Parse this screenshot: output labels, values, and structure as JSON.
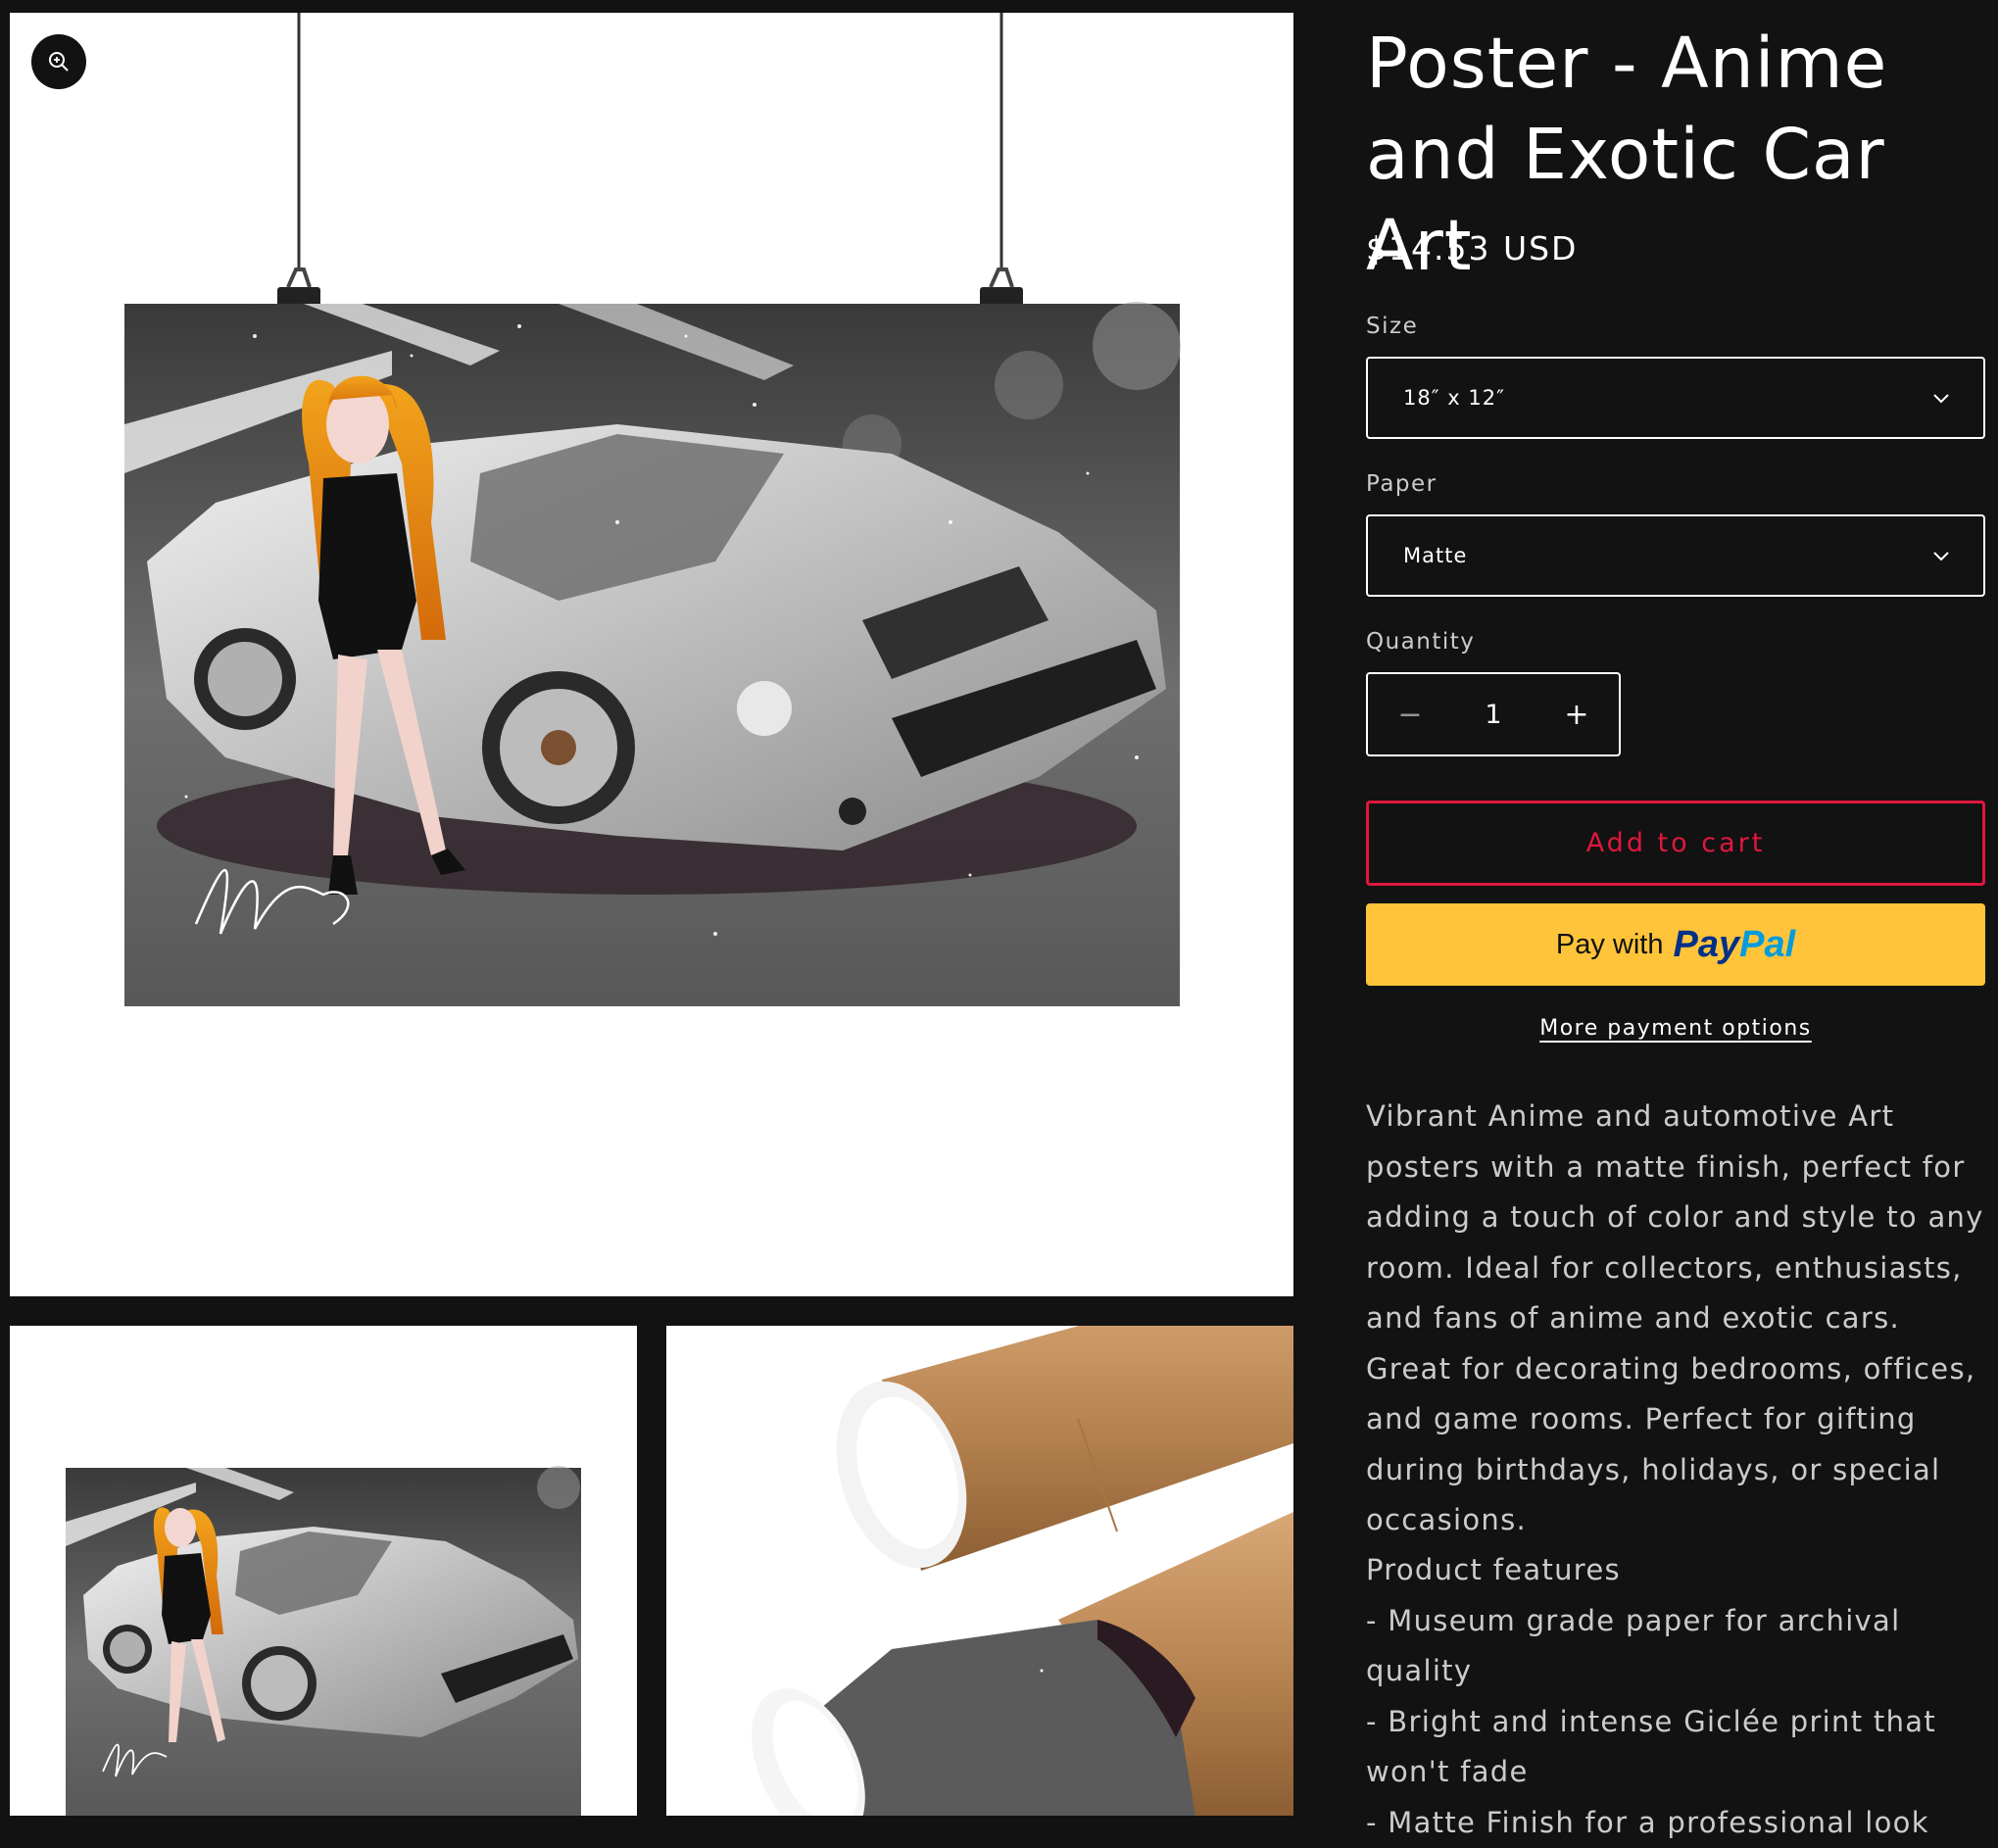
{
  "product": {
    "title": "Poster - Anime and Exotic Car Art",
    "price": "$14.53 USD"
  },
  "options": {
    "size_label": "Size",
    "size_value": "18″ x 12″",
    "paper_label": "Paper",
    "paper_value": "Matte"
  },
  "quantity": {
    "label": "Quantity",
    "value": "1",
    "minus": "−",
    "plus": "+"
  },
  "actions": {
    "add_to_cart": "Add to cart",
    "paypal_prefix": "Pay with",
    "paypal_brand_a": "Pay",
    "paypal_brand_b": "Pal",
    "more_payment": "More payment options"
  },
  "description": "Vibrant Anime and automotive Art posters with a matte finish, perfect for adding a touch of color and style to any room. Ideal for collectors, enthusiasts, and fans of anime and exotic cars. Great for decorating bedrooms, offices, and game rooms. Perfect for gifting during birthdays, holidays, or special occasions.",
  "features": {
    "heading": "Product features",
    "items": [
      "- Museum grade paper for archival quality",
      "- Bright and intense Giclée print that won't fade",
      "- Matte Finish for a professional look"
    ]
  },
  "colors": {
    "background": "#121212",
    "accent_red": "#e0173c",
    "paypal_yellow": "#ffc439",
    "paypal_dark_blue": "#003087",
    "paypal_light_blue": "#009cde"
  },
  "icons": {
    "zoom": "zoom-in-icon",
    "chevron": "chevron-down-icon"
  }
}
